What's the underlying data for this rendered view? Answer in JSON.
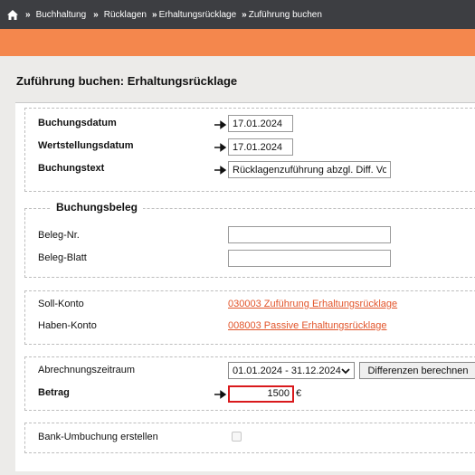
{
  "breadcrumb": {
    "home_icon": "home-icon",
    "separator": "»",
    "items": [
      "Buchhaltung",
      "Rücklagen",
      "Erhaltungsrücklage",
      "Zuführung buchen"
    ]
  },
  "page": {
    "title": "Zuführung buchen: Erhaltungsrücklage"
  },
  "colors": {
    "topbar": "#3d3e42",
    "accent_band": "#f4874d",
    "link": "#e2552b",
    "error_border": "#d9191c"
  },
  "booking": {
    "date_label": "Buchungsdatum",
    "date_value": "17.01.2024",
    "valuta_label": "Wertstellungsdatum",
    "valuta_value": "17.01.2024",
    "text_label": "Buchungstext",
    "text_value": "Rücklagenzuführung abzgl. Diff. Vor."
  },
  "beleg": {
    "legend": "Buchungsbeleg",
    "nr_label": "Beleg-Nr.",
    "nr_value": "",
    "blatt_label": "Beleg-Blatt",
    "blatt_value": ""
  },
  "accounts": {
    "soll_label": "Soll-Konto",
    "soll_value": "030003 Zuführung Erhaltungsrücklage",
    "haben_label": "Haben-Konto",
    "haben_value": "008003 Passive Erhaltungsrücklage"
  },
  "period": {
    "label": "Abrechnungszeitraum",
    "selected": "01.01.2024 - 31.12.2024",
    "button_label": "Differenzen berechnen",
    "amount_label": "Betrag",
    "amount_value": "1500",
    "currency": "€"
  },
  "bank": {
    "label": "Bank-Umbuchung erstellen",
    "checked": false
  }
}
